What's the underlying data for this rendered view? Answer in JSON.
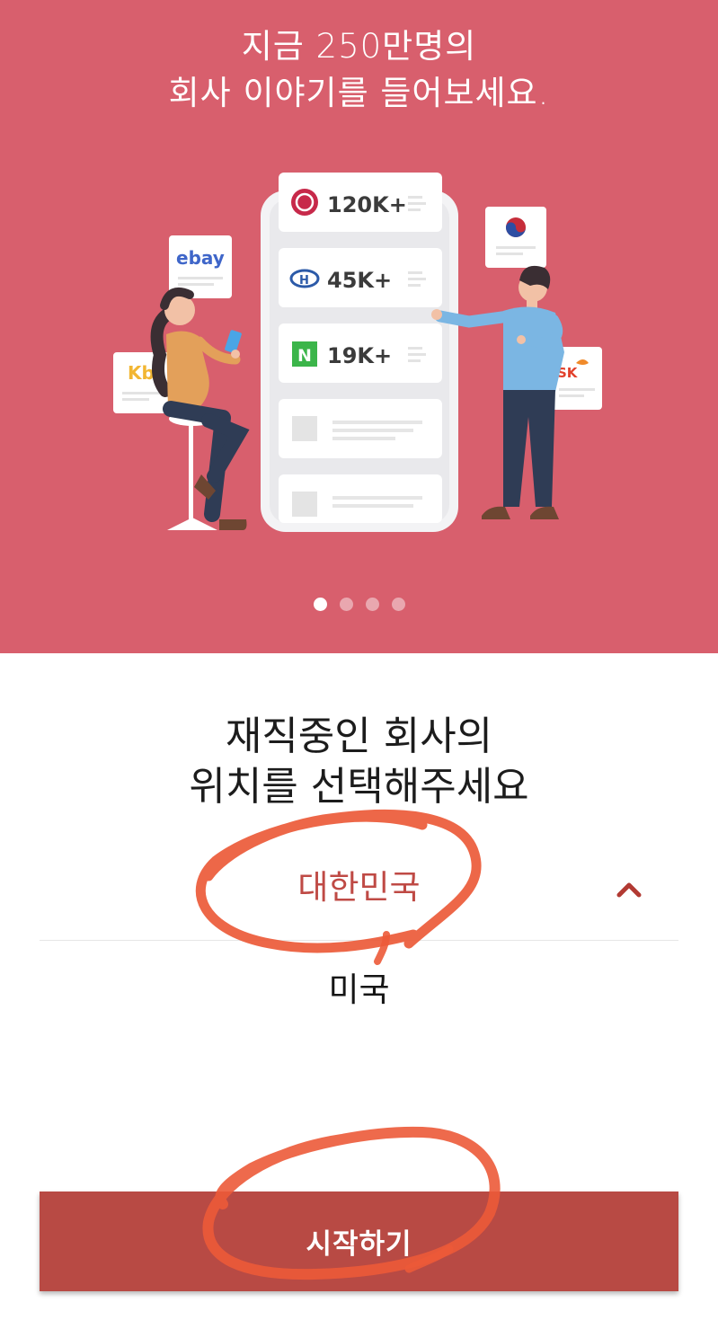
{
  "hero": {
    "title_line1": "지금 250만명의",
    "title_line2": "회사 이야기를 들어보세요.",
    "background_color": "#d85f6d",
    "cards": [
      {
        "logo": "lg-logo-icon",
        "count": "120K+"
      },
      {
        "logo": "hyundai-logo-icon",
        "count": "45K+"
      },
      {
        "logo": "naver-logo-icon",
        "logo_text": "N",
        "count": "19K+"
      }
    ],
    "floating_logos": {
      "ebay": "ebay",
      "kb": "Kb",
      "sk": "SK"
    },
    "pager": {
      "total": 4,
      "active_index": 0
    }
  },
  "question": {
    "line1": "재직중인 회사의",
    "line2": "위치를 선택해주세요"
  },
  "country_picker": {
    "selected": "대한민국",
    "options": [
      "미국"
    ],
    "expanded": true,
    "accent_color": "#bf4a45"
  },
  "start_button": {
    "label": "시작하기",
    "color": "#b84a44"
  },
  "annotation_color": "#ec5a38"
}
